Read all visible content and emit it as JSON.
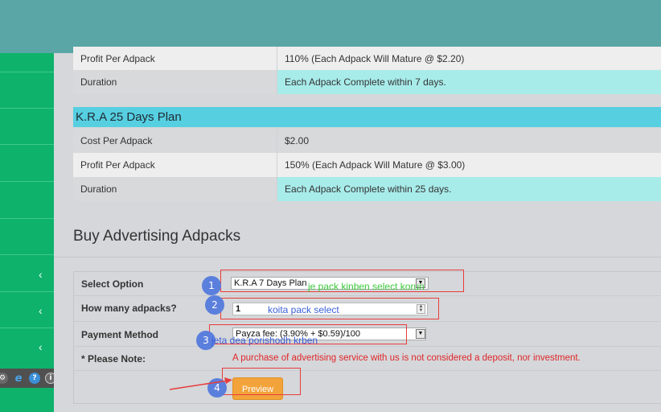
{
  "top_plan_rows": [
    {
      "label": "Profit Per Adpack",
      "value": "110% (Each Adpack Will Mature @ $2.20)"
    },
    {
      "label": "Duration",
      "value": "Each Adpack Complete within 7 days."
    }
  ],
  "plan25": {
    "title": "K.R.A 25 Days Plan",
    "rows": [
      {
        "label": "Cost Per Adpack",
        "value": "$2.00"
      },
      {
        "label": "Profit Per Adpack",
        "value": "150% (Each Adpack Will Mature @ $3.00)"
      },
      {
        "label": "Duration",
        "value": "Each Adpack Complete within 25 days."
      }
    ]
  },
  "buy": {
    "title": "Buy Advertising Adpacks",
    "select_label": "Select Option",
    "select_value": "K.R.A 7 Days Plan",
    "qty_label": "How many adpacks?",
    "qty_value": "1",
    "payment_label": "Payment Method",
    "payment_value": "Payza fee: (3.90% + $0.59)/100",
    "note_label": "* Please Note:",
    "note_text": "A purchase of advertising service with us is not considered a deposit, nor investment.",
    "preview_label": "Preview"
  },
  "annotations": {
    "step1": "1",
    "step2": "2",
    "step3": "3",
    "step4": "4",
    "note1": "je pack kinben select korun",
    "note2": "koita pack select",
    "note3": "jeta dea porishodh krben",
    "note1_color": "#3cc93c",
    "note2_color": "#3a5fd8",
    "note3_color": "#3a5fd8"
  },
  "toolbar_icons": [
    "settings-icon",
    "ie-icon",
    "help-icon",
    "info-icon"
  ],
  "sidebar_chevron": "‹",
  "colors": {
    "topbar": "#5aa6a6",
    "sidebar": "#0fb26b",
    "plan_header": "#56cfe1",
    "highlight_cell": "#a8ecea",
    "preview_button": "#f2a33a",
    "annotation_red": "#e83b3b",
    "annotation_circle": "#5b7fdc"
  }
}
